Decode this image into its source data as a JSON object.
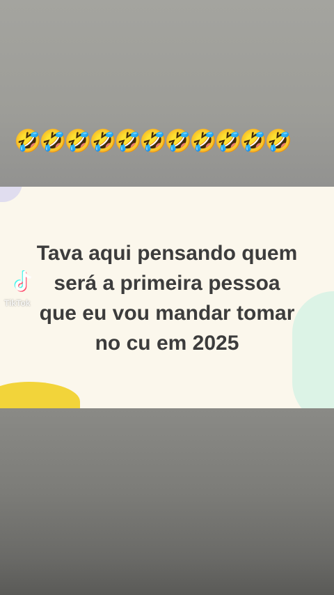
{
  "emoji_row": {
    "emoji": "🤣",
    "count": 11
  },
  "card": {
    "lines": [
      "Tava aqui pensando quem",
      "será a primeira pessoa",
      "que eu vou mandar tomar",
      "no cu em 2025"
    ]
  },
  "watermark": {
    "platform": "TikTok",
    "icon": "tiktok-logo-icon",
    "handle": "TikTok"
  },
  "colors": {
    "card_background": "#fbf7ec",
    "text": "#3c3c3c",
    "accent_yellow": "#f2d43a",
    "accent_mint": "#d8f2e6",
    "accent_lavender": "#d9d6f0"
  }
}
